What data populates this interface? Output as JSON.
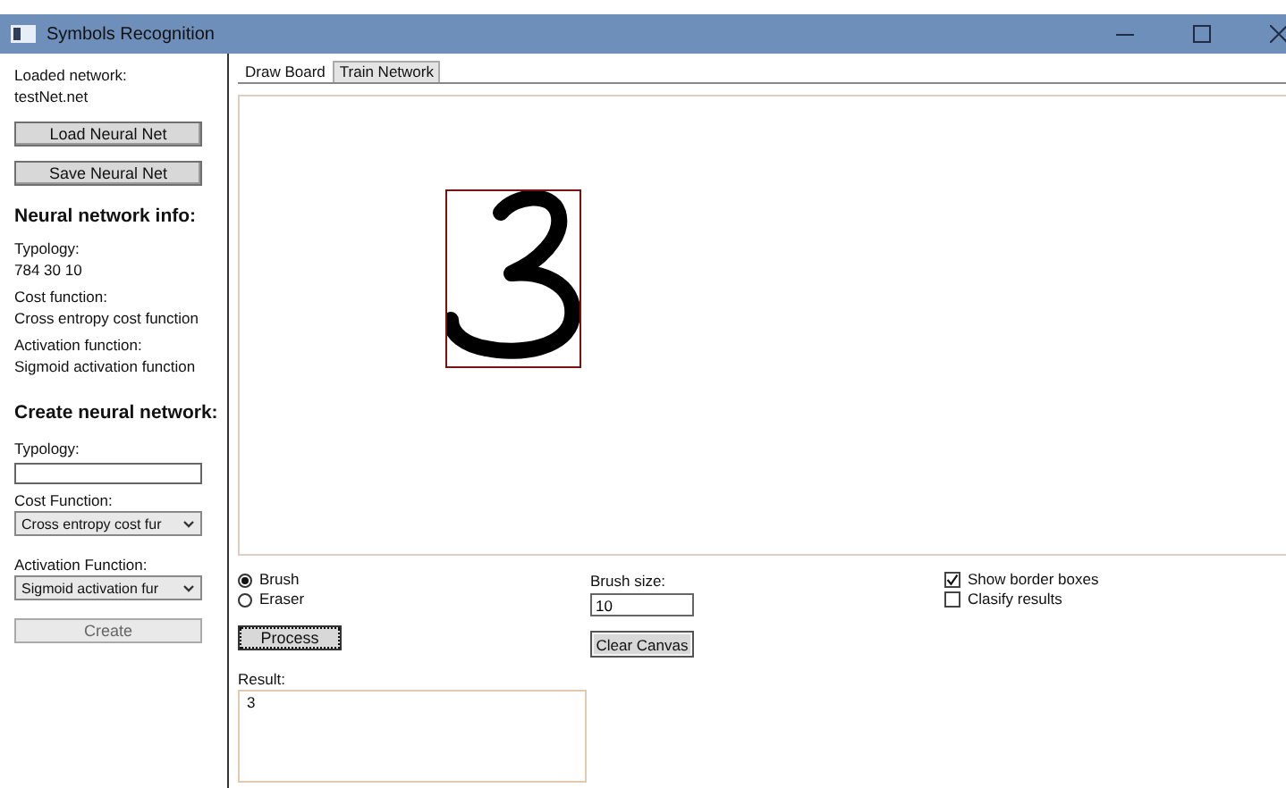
{
  "window": {
    "title": "Symbols Recognition"
  },
  "sidebar": {
    "loaded_label": "Loaded network:",
    "loaded_value": "testNet.net",
    "buttons": [
      {
        "label": "Load Neural Net"
      },
      {
        "label": "Save Neural Net"
      }
    ],
    "info_heading": "Neural network info:",
    "info": [
      {
        "label": "Typology:",
        "value": "784 30 10"
      },
      {
        "label": "Cost function:",
        "value": "Cross entropy cost function"
      },
      {
        "label": "Activation function:",
        "value": "Sigmoid activation function"
      }
    ],
    "create_heading": "Create neural network:",
    "typology_label": "Typology:",
    "cost_label": "Cost Function:",
    "cost_value": "Cross entropy cost fur",
    "activation_label": "Activation Function:",
    "activation_value": "Sigmoid activation fur",
    "create_button": {
      "label": "Create",
      "disabled": true
    }
  },
  "tabs": [
    {
      "label": "Draw Board",
      "selected": true
    },
    {
      "label": "Train Network",
      "selected": false
    }
  ],
  "canvas": {
    "show_border_box": true
  },
  "tools": {
    "modes": [
      {
        "label": "Brush",
        "selected": true
      },
      {
        "label": "Eraser",
        "selected": false
      }
    ],
    "brush_size_label": "Brush size:",
    "brush_size": "10",
    "process_button": {
      "label": "Process",
      "focused": true
    },
    "clear_button": {
      "label": "Clear Canvas"
    },
    "options": [
      {
        "label": "Show border boxes",
        "checked": true
      },
      {
        "label": "Clasify results",
        "checked": false
      }
    ],
    "result_label": "Result:",
    "result": "3"
  }
}
